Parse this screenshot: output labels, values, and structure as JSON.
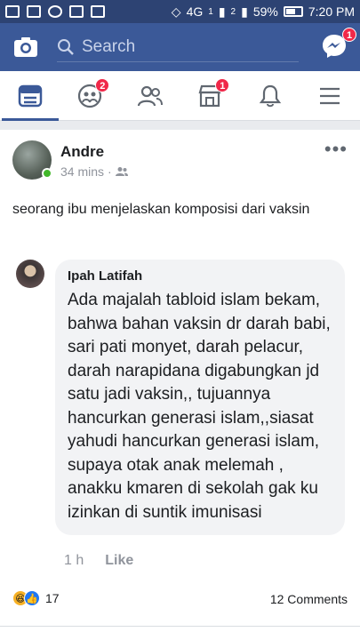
{
  "status_bar": {
    "network": "4G",
    "sim1": "1",
    "sim2": "2",
    "battery": "59%",
    "time": "7:20 PM"
  },
  "top_bar": {
    "search_placeholder": "Search",
    "messenger_badge": "1"
  },
  "nav": {
    "friends_badge": "2",
    "marketplace_badge": "1"
  },
  "post": {
    "author": "Andre",
    "time": "34 mins",
    "text": "seorang ibu menjelaskan komposisi dari vaksin"
  },
  "comment": {
    "author": "Ipah Latifah",
    "text": "Ada majalah tabloid islam bekam, bahwa bahan vaksin dr darah babi, sari pati monyet, darah pelacur, darah narapidana digabungkan jd satu jadi vaksin,, tujuannya hancurkan generasi islam,,siasat yahudi hancurkan generasi islam, supaya otak anak melemah , anakku kmaren di sekolah gak ku izinkan di suntik imunisasi",
    "time": "1 h",
    "like_label": "Like"
  },
  "reactions": {
    "count": "17",
    "comments": "12 Comments"
  },
  "colors": {
    "brand": "#3b5998",
    "badge": "#f02849",
    "online": "#42b72a"
  }
}
